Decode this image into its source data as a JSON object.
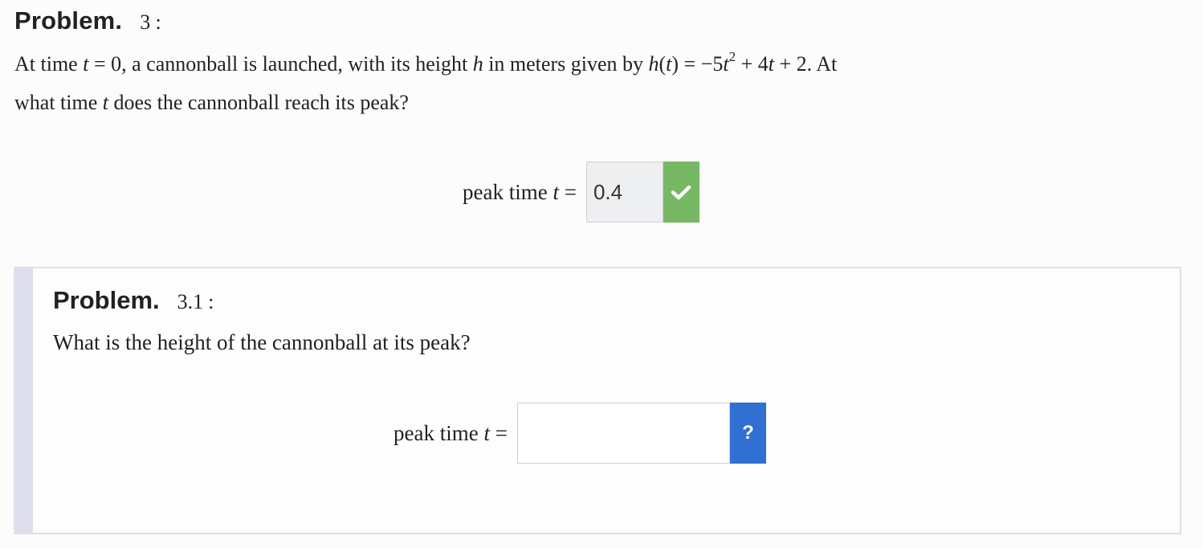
{
  "problem": {
    "label": "Problem.",
    "number": "3",
    "colon": ":",
    "text_line1_parts": {
      "a": "At time ",
      "t1": "t",
      "b": " = 0, a cannonball is launched, with its height ",
      "h1": "h",
      "c": " in meters given by ",
      "h2": "h",
      "d": "(",
      "t2": "t",
      "e": ") = −5",
      "t3": "t",
      "exp": "2",
      "f": " + 4",
      "t4": "t",
      "g": " + 2. At"
    },
    "text_line2_parts": {
      "a": "what time ",
      "t": "t",
      "b": " does the cannonball reach its peak?"
    },
    "answer": {
      "label_text": "peak time ",
      "label_var": "t",
      "label_eq": " =",
      "value": "0.4",
      "status": "correct",
      "status_icon": "checkmark-icon",
      "status_color": "#77b865"
    }
  },
  "subproblem": {
    "label": "Problem.",
    "number": "3.1",
    "colon": ":",
    "text": "What is the height of the cannonball at its peak?",
    "answer": {
      "label_text": "peak time ",
      "label_var": "t",
      "label_eq": " =",
      "value": "",
      "help_label": "?",
      "help_color": "#3070d3"
    }
  }
}
